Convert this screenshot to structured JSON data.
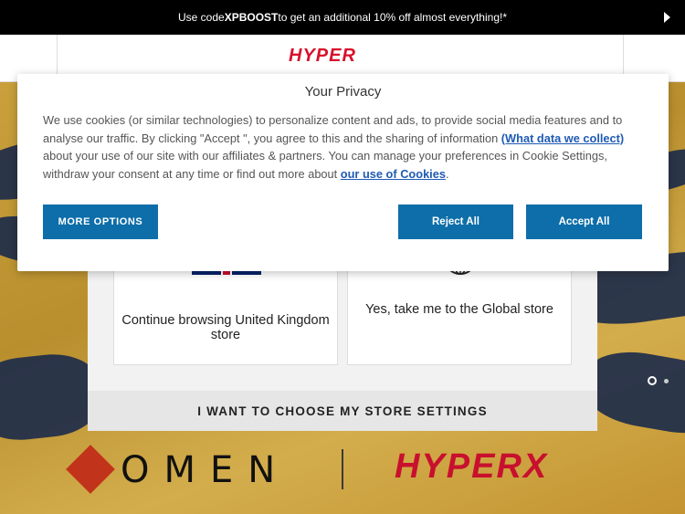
{
  "promo": {
    "prefix": "Use code ",
    "code": "XPBOOST",
    "suffix": " to get an additional 10% off almost everything!*"
  },
  "header": {
    "logo_text": "HYPER"
  },
  "privacy": {
    "title": "Your Privacy",
    "text_1": "We use cookies (or similar technologies) to personalize content and ads, to provide social media features and to analyse our traffic. By clicking \"Accept \", you agree to this and the sharing of information ",
    "link_1": "(What data we collect)",
    "text_2": " about your use of our site with our affiliates & partners. You can manage your preferences in Cookie Settings, withdraw your consent at any time or find out more about ",
    "link_2": "our use of Cookies",
    "text_3": ".",
    "more_options": "MORE OPTIONS",
    "reject_all": "Reject All",
    "accept_all": "Accept All"
  },
  "store": {
    "uk_label": "Continue browsing United Kingdom store",
    "global_label": "Yes, take me to the Global store",
    "settings_label": "I WANT TO CHOOSE MY STORE SETTINGS"
  },
  "brands": {
    "omen": "OMEN",
    "hyperx": "HYPERX"
  },
  "colors": {
    "accent": "#0d6ea9",
    "brand_red": "#d8102a",
    "link": "#1f5bb4"
  }
}
